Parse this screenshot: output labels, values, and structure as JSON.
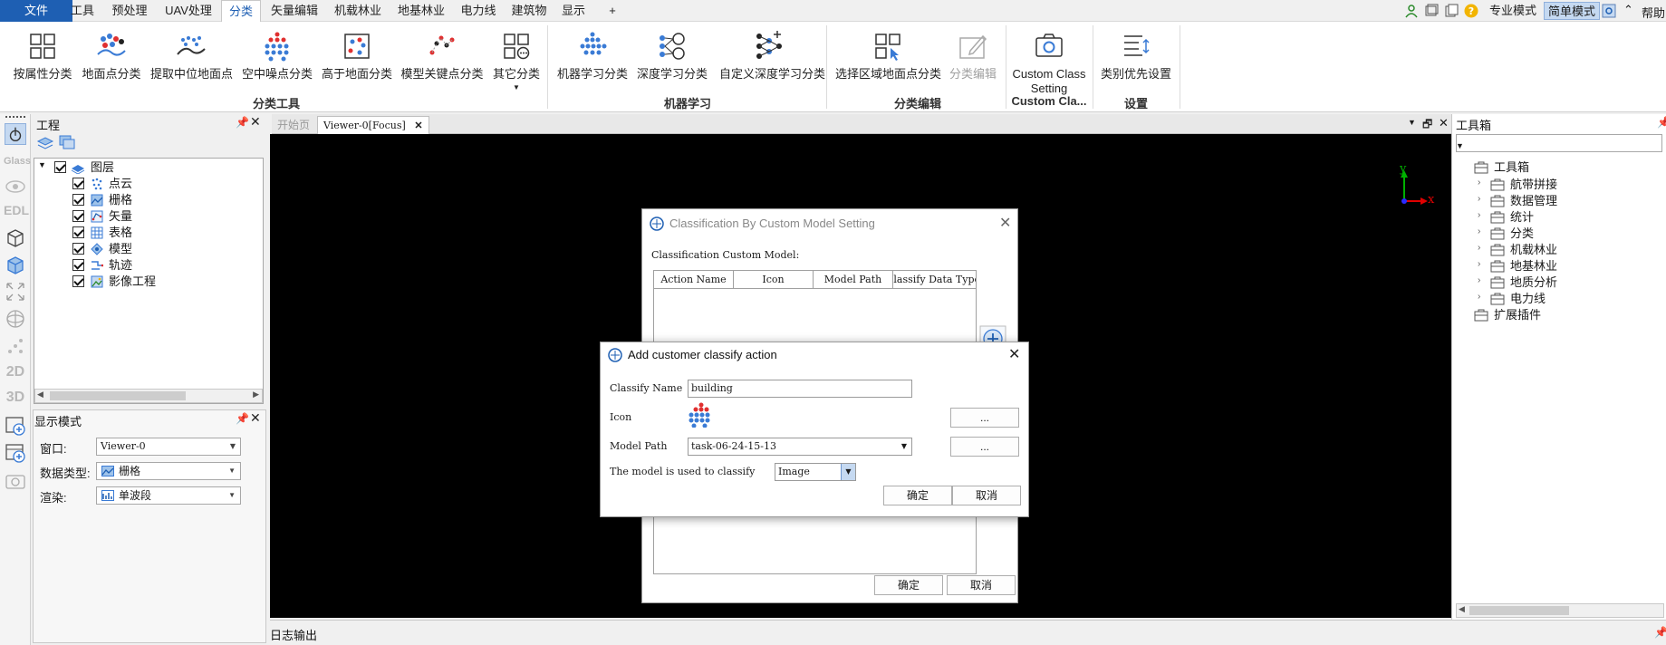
{
  "menu": {
    "tabs": [
      "文件",
      "工具",
      "预处理",
      "UAV处理",
      "分类",
      "矢量编辑",
      "机载林业",
      "地基林业",
      "电力线",
      "建筑物",
      "显示",
      "+"
    ],
    "active_index": 4,
    "right": {
      "expert_mode": "专业模式",
      "simple_mode": "简单模式",
      "help": "帮助"
    }
  },
  "ribbon": {
    "groups": [
      {
        "label": "分类工具",
        "buttons": [
          "按属性分类",
          "地面点分类",
          "提取中位地面点",
          "空中噪点分类",
          "高于地面分类",
          "模型关键点分类",
          "其它分类"
        ]
      },
      {
        "label": "机器学习",
        "buttons": [
          "机器学习分类",
          "深度学习分类",
          "自定义深度学习分类"
        ]
      },
      {
        "label": "分类编辑",
        "buttons": [
          "选择区域地面点分类",
          "分类编辑"
        ]
      },
      {
        "label": "Custom Cla...",
        "buttons": [
          "Custom Class Setting"
        ]
      },
      {
        "label": "设置",
        "buttons": [
          "类别优先设置"
        ]
      }
    ]
  },
  "left_toolbar": {
    "glass": "Glass",
    "edl": "EDL",
    "view2d": "2D",
    "view3d": "3D"
  },
  "project_panel": {
    "title": "工程",
    "root": "图层",
    "items": [
      "点云",
      "栅格",
      "矢量",
      "表格",
      "模型",
      "轨迹",
      "影像工程"
    ]
  },
  "display_panel": {
    "title": "显示模式",
    "window_label": "窗口:",
    "window_value": "Viewer-0",
    "datatype_label": "数据类型:",
    "datatype_value": "栅格",
    "render_label": "渲染:",
    "render_value": "单波段"
  },
  "viewer": {
    "tabs": [
      "开始页",
      "Viewer-0[Focus]"
    ],
    "axis_y": "y",
    "axis_x": "x"
  },
  "toolbox": {
    "title": "工具箱",
    "root": "工具箱",
    "items": [
      "航带拼接",
      "数据管理",
      "统计",
      "分类",
      "机载林业",
      "地基林业",
      "地质分析",
      "电力线"
    ],
    "plugin": "扩展插件"
  },
  "log": {
    "title": "日志输出"
  },
  "dialog_setting": {
    "title": "Classification By Custom Model Setting",
    "section_label": "Classification Custom Model:",
    "columns": [
      "Action Name",
      "Icon",
      "Model Path",
      "Classify Data Type"
    ],
    "ok": "确定",
    "cancel": "取消"
  },
  "dialog_add": {
    "title": "Add customer classify action",
    "name_label": "Classify Name",
    "name_value": "building",
    "icon_label": "Icon",
    "browse": "...",
    "path_label": "Model Path",
    "path_value": "task-06-24-15-13",
    "type_label": "The model is used to classify",
    "type_value": "Image",
    "ok": "确定",
    "cancel": "取消"
  },
  "colors": {
    "accent": "#1e5fb3",
    "viewer_bg": "#000000",
    "axis_y": "#00b000",
    "axis_x": "#e00000"
  }
}
